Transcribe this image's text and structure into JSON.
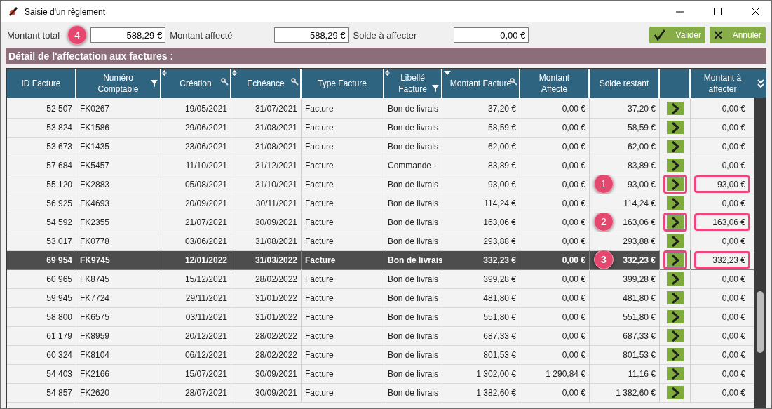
{
  "window": {
    "title": "Saisie d'un règlement"
  },
  "totals": [
    {
      "label": "Montant total",
      "value": "588,29 €",
      "callout": "4"
    },
    {
      "label": "Montant affecté",
      "value": "588,29 €"
    },
    {
      "label": "Solde à affecter",
      "value": "0,00 €"
    }
  ],
  "buttons": [
    {
      "kind": "validate",
      "label": "Valider"
    },
    {
      "kind": "cancel",
      "label": "Annuler"
    }
  ],
  "section_title": "Détail de l'affectation aux factures :",
  "table": {
    "columns": [
      {
        "label": "ID Facture"
      },
      {
        "label": "Numéro Comptable"
      },
      {
        "label": "Création"
      },
      {
        "label": "Echéance"
      },
      {
        "label": "Type Facture"
      },
      {
        "label": "Libellé Facture"
      },
      {
        "label": "Montant Facture"
      },
      {
        "label": "Montant Affecté"
      },
      {
        "label": "Solde restant"
      },
      {},
      {
        "label": "Montant à affecter"
      }
    ],
    "rows": [
      {
        "id": "52 507",
        "num": "FK0267",
        "creation": "19/05/2021",
        "echeance": "31/07/2021",
        "type": "Facture",
        "libelle": "Bon de livrais",
        "montant": "37,20 €",
        "affecte": "0,00 €",
        "solde": "37,20 €",
        "a_affecter": "0,00 €",
        "selected": false,
        "highlighted": false
      },
      {
        "id": "53 824",
        "num": "FK1586",
        "creation": "29/06/2021",
        "echeance": "31/08/2021",
        "type": "Facture",
        "libelle": "Bon de livrais",
        "montant": "58,59 €",
        "affecte": "0,00 €",
        "solde": "58,59 €",
        "a_affecter": "0,00 €",
        "selected": false,
        "highlighted": false
      },
      {
        "id": "53 673",
        "num": "FK1435",
        "creation": "23/06/2021",
        "echeance": "31/08/2021",
        "type": "Facture",
        "libelle": "Bon de livrais",
        "montant": "62,00 €",
        "affecte": "0,00 €",
        "solde": "62,00 €",
        "a_affecter": "0,00 €",
        "selected": false,
        "highlighted": false
      },
      {
        "id": "57 684",
        "num": "FK5457",
        "creation": "11/10/2021",
        "echeance": "31/12/2021",
        "type": "Facture",
        "libelle": "Commande -",
        "montant": "83,89 €",
        "affecte": "0,00 €",
        "solde": "83,89 €",
        "a_affecter": "0,00 €",
        "selected": false,
        "highlighted": false
      },
      {
        "id": "55 120",
        "num": "FK2883",
        "creation": "05/08/2021",
        "echeance": "31/10/2021",
        "type": "Facture",
        "libelle": "Bon de livrais",
        "montant": "93,00 €",
        "affecte": "0,00 €",
        "solde": "93,00 €",
        "a_affecter": "93,00 €",
        "selected": false,
        "highlighted": true,
        "callout": "1"
      },
      {
        "id": "56 925",
        "num": "FK4693",
        "creation": "20/09/2021",
        "echeance": "30/11/2021",
        "type": "Facture",
        "libelle": "Bon de livrais",
        "montant": "114,24 €",
        "affecte": "0,00 €",
        "solde": "114,24 €",
        "a_affecter": "0,00 €",
        "selected": false,
        "highlighted": false
      },
      {
        "id": "54 592",
        "num": "FK2355",
        "creation": "21/07/2021",
        "echeance": "30/09/2021",
        "type": "Facture",
        "libelle": "Bon de livrais",
        "montant": "163,06 €",
        "affecte": "0,00 €",
        "solde": "163,06 €",
        "a_affecter": "163,06 €",
        "selected": false,
        "highlighted": true,
        "callout": "2"
      },
      {
        "id": "53 017",
        "num": "FK0778",
        "creation": "03/06/2021",
        "echeance": "31/08/2021",
        "type": "Facture",
        "libelle": "Bon de livrais",
        "montant": "293,88 €",
        "affecte": "0,00 €",
        "solde": "293,88 €",
        "a_affecter": "0,00 €",
        "selected": false,
        "highlighted": false
      },
      {
        "id": "69 954",
        "num": "FK9745",
        "creation": "12/01/2022",
        "echeance": "31/03/2022",
        "type": "Facture",
        "libelle": "Bon de livrais",
        "montant": "332,23 €",
        "affecte": "0,00 €",
        "solde": "332,23 €",
        "a_affecter": "332,23 €",
        "selected": true,
        "highlighted": true,
        "callout": "3"
      },
      {
        "id": "60 965",
        "num": "FK8745",
        "creation": "15/12/2021",
        "echeance": "28/02/2022",
        "type": "Facture",
        "libelle": "Bon de livrais",
        "montant": "399,28 €",
        "affecte": "0,00 €",
        "solde": "399,28 €",
        "a_affecter": "0,00 €",
        "selected": false,
        "highlighted": false
      },
      {
        "id": "59 945",
        "num": "FK7724",
        "creation": "29/11/2021",
        "echeance": "31/01/2022",
        "type": "Facture",
        "libelle": "Bon de livrais",
        "montant": "481,80 €",
        "affecte": "0,00 €",
        "solde": "481,80 €",
        "a_affecter": "0,00 €",
        "selected": false,
        "highlighted": false
      },
      {
        "id": "58 800",
        "num": "FK6575",
        "creation": "03/11/2021",
        "echeance": "31/01/2022",
        "type": "Facture",
        "libelle": "Bon de livrais",
        "montant": "551,80 €",
        "affecte": "0,00 €",
        "solde": "551,80 €",
        "a_affecter": "0,00 €",
        "selected": false,
        "highlighted": false
      },
      {
        "id": "61 179",
        "num": "FK8959",
        "creation": "20/12/2021",
        "echeance": "28/02/2022",
        "type": "Facture",
        "libelle": "Bon de livrais",
        "montant": "687,33 €",
        "affecte": "0,00 €",
        "solde": "687,33 €",
        "a_affecter": "0,00 €",
        "selected": false,
        "highlighted": false
      },
      {
        "id": "60 324",
        "num": "FK8104",
        "creation": "06/12/2021",
        "echeance": "28/02/2022",
        "type": "Facture",
        "libelle": "Bon de livrais",
        "montant": "801,53 €",
        "affecte": "0,00 €",
        "solde": "801,53 €",
        "a_affecter": "0,00 €",
        "selected": false,
        "highlighted": false
      },
      {
        "id": "54 403",
        "num": "FK2166",
        "creation": "15/07/2021",
        "echeance": "30/09/2021",
        "type": "Facture",
        "libelle": "Bon de livrais",
        "montant": "1 302,00 €",
        "affecte": "1 290,84 €",
        "solde": "11,16 €",
        "a_affecter": "0,00 €",
        "selected": false,
        "highlighted": false
      },
      {
        "id": "54 857",
        "num": "FK2620",
        "creation": "28/07/2021",
        "echeance": "30/09/2021",
        "type": "Facture",
        "libelle": "Bon de livrais",
        "montant": "1 382,60 €",
        "affecte": "0,00 €",
        "solde": "1 382,60 €",
        "a_affecter": "0,00 €",
        "selected": false,
        "highlighted": false
      }
    ]
  }
}
